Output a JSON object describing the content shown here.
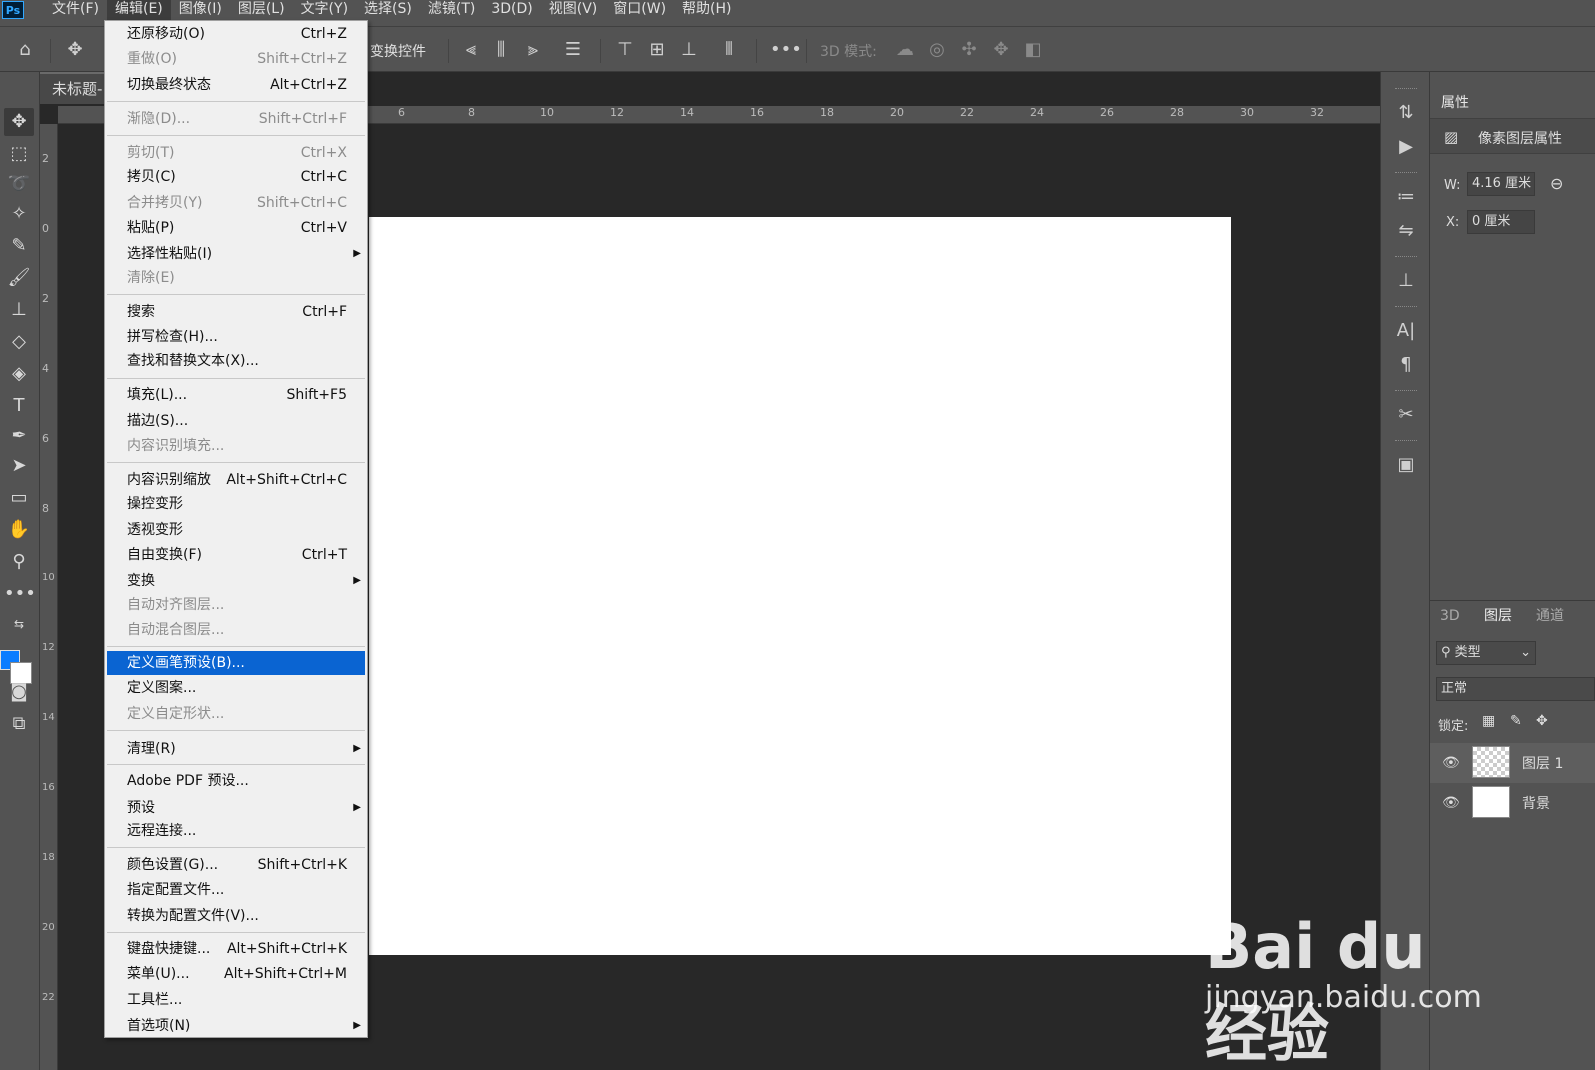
{
  "menubar": {
    "logo": "Ps",
    "items": [
      "文件(F)",
      "编辑(E)",
      "图像(I)",
      "图层(L)",
      "文字(Y)",
      "选择(S)",
      "滤镜(T)",
      "3D(D)",
      "视图(V)",
      "窗口(W)",
      "帮助(H)"
    ]
  },
  "optbar": {
    "transform_controls": "变换控件",
    "mode_3d": "3D 模式:"
  },
  "document": {
    "tab_title": "未标题-",
    "ruler_top": [
      "6",
      "8",
      "10",
      "12",
      "14",
      "16",
      "18",
      "20",
      "22",
      "24",
      "26",
      "28",
      "30",
      "32"
    ],
    "ruler_left": [
      "2",
      "0",
      "2",
      "4",
      "6",
      "8",
      "10",
      "12",
      "14",
      "16",
      "18",
      "20",
      "22"
    ]
  },
  "colors": {
    "foreground": "#0a7cff",
    "background": "#ffffff",
    "highlight": "#0a64d2"
  },
  "properties": {
    "tab": "属性",
    "header": "像素图层属性",
    "w_label": "W:",
    "w_value": "4.16 厘米",
    "x_label": "X:",
    "x_value": "0 厘米"
  },
  "layers": {
    "tabs": [
      "3D",
      "图层",
      "通道"
    ],
    "filter": "类型",
    "blend_mode": "正常",
    "lock_label": "锁定:",
    "rows": [
      {
        "name": "图层 1"
      },
      {
        "name": "背景"
      }
    ]
  },
  "edit_menu": {
    "items": [
      {
        "label": "还原移动(O)",
        "shortcut": "Ctrl+Z",
        "disabled": false
      },
      {
        "label": "重做(O)",
        "shortcut": "Shift+Ctrl+Z",
        "disabled": true
      },
      {
        "label": "切换最终状态",
        "shortcut": "Alt+Ctrl+Z",
        "disabled": false
      },
      {
        "label": "渐隐(D)...",
        "shortcut": "Shift+Ctrl+F",
        "disabled": true
      },
      {
        "label": "剪切(T)",
        "shortcut": "Ctrl+X",
        "disabled": true
      },
      {
        "label": "拷贝(C)",
        "shortcut": "Ctrl+C",
        "disabled": false
      },
      {
        "label": "合并拷贝(Y)",
        "shortcut": "Shift+Ctrl+C",
        "disabled": true
      },
      {
        "label": "粘贴(P)",
        "shortcut": "Ctrl+V",
        "disabled": false
      },
      {
        "label": "选择性粘贴(I)",
        "shortcut": "",
        "disabled": false
      },
      {
        "label": "清除(E)",
        "shortcut": "",
        "disabled": true
      },
      {
        "label": "搜索",
        "shortcut": "Ctrl+F",
        "disabled": false
      },
      {
        "label": "拼写检查(H)...",
        "shortcut": "",
        "disabled": false
      },
      {
        "label": "查找和替换文本(X)...",
        "shortcut": "",
        "disabled": false
      },
      {
        "label": "填充(L)...",
        "shortcut": "Shift+F5",
        "disabled": false
      },
      {
        "label": "描边(S)...",
        "shortcut": "",
        "disabled": false
      },
      {
        "label": "内容识别填充...",
        "shortcut": "",
        "disabled": true
      },
      {
        "label": "内容识别缩放",
        "shortcut": "Alt+Shift+Ctrl+C",
        "disabled": false
      },
      {
        "label": "操控变形",
        "shortcut": "",
        "disabled": false
      },
      {
        "label": "透视变形",
        "shortcut": "",
        "disabled": false
      },
      {
        "label": "自由变换(F)",
        "shortcut": "Ctrl+T",
        "disabled": false
      },
      {
        "label": "变换",
        "shortcut": "",
        "disabled": false
      },
      {
        "label": "自动对齐图层...",
        "shortcut": "",
        "disabled": true
      },
      {
        "label": "自动混合图层...",
        "shortcut": "",
        "disabled": true
      },
      {
        "label": "定义画笔预设(B)...",
        "shortcut": "",
        "disabled": false
      },
      {
        "label": "定义图案...",
        "shortcut": "",
        "disabled": false
      },
      {
        "label": "定义自定形状...",
        "shortcut": "",
        "disabled": true
      },
      {
        "label": "清理(R)",
        "shortcut": "",
        "disabled": false
      },
      {
        "label": "Adobe PDF 预设...",
        "shortcut": "",
        "disabled": false
      },
      {
        "label": "预设",
        "shortcut": "",
        "disabled": false
      },
      {
        "label": "远程连接...",
        "shortcut": "",
        "disabled": false
      },
      {
        "label": "颜色设置(G)...",
        "shortcut": "Shift+Ctrl+K",
        "disabled": false
      },
      {
        "label": "指定配置文件...",
        "shortcut": "",
        "disabled": false
      },
      {
        "label": "转换为配置文件(V)...",
        "shortcut": "",
        "disabled": false
      },
      {
        "label": "键盘快捷键...",
        "shortcut": "Alt+Shift+Ctrl+K",
        "disabled": false
      },
      {
        "label": "菜单(U)...",
        "shortcut": "Alt+Shift+Ctrl+M",
        "disabled": false
      },
      {
        "label": "工具栏...",
        "shortcut": "",
        "disabled": false
      },
      {
        "label": "首选项(N)",
        "shortcut": "",
        "disabled": false
      }
    ]
  },
  "watermark": {
    "brand": "Bai du 经验",
    "url": "jingyan.baidu.com"
  }
}
